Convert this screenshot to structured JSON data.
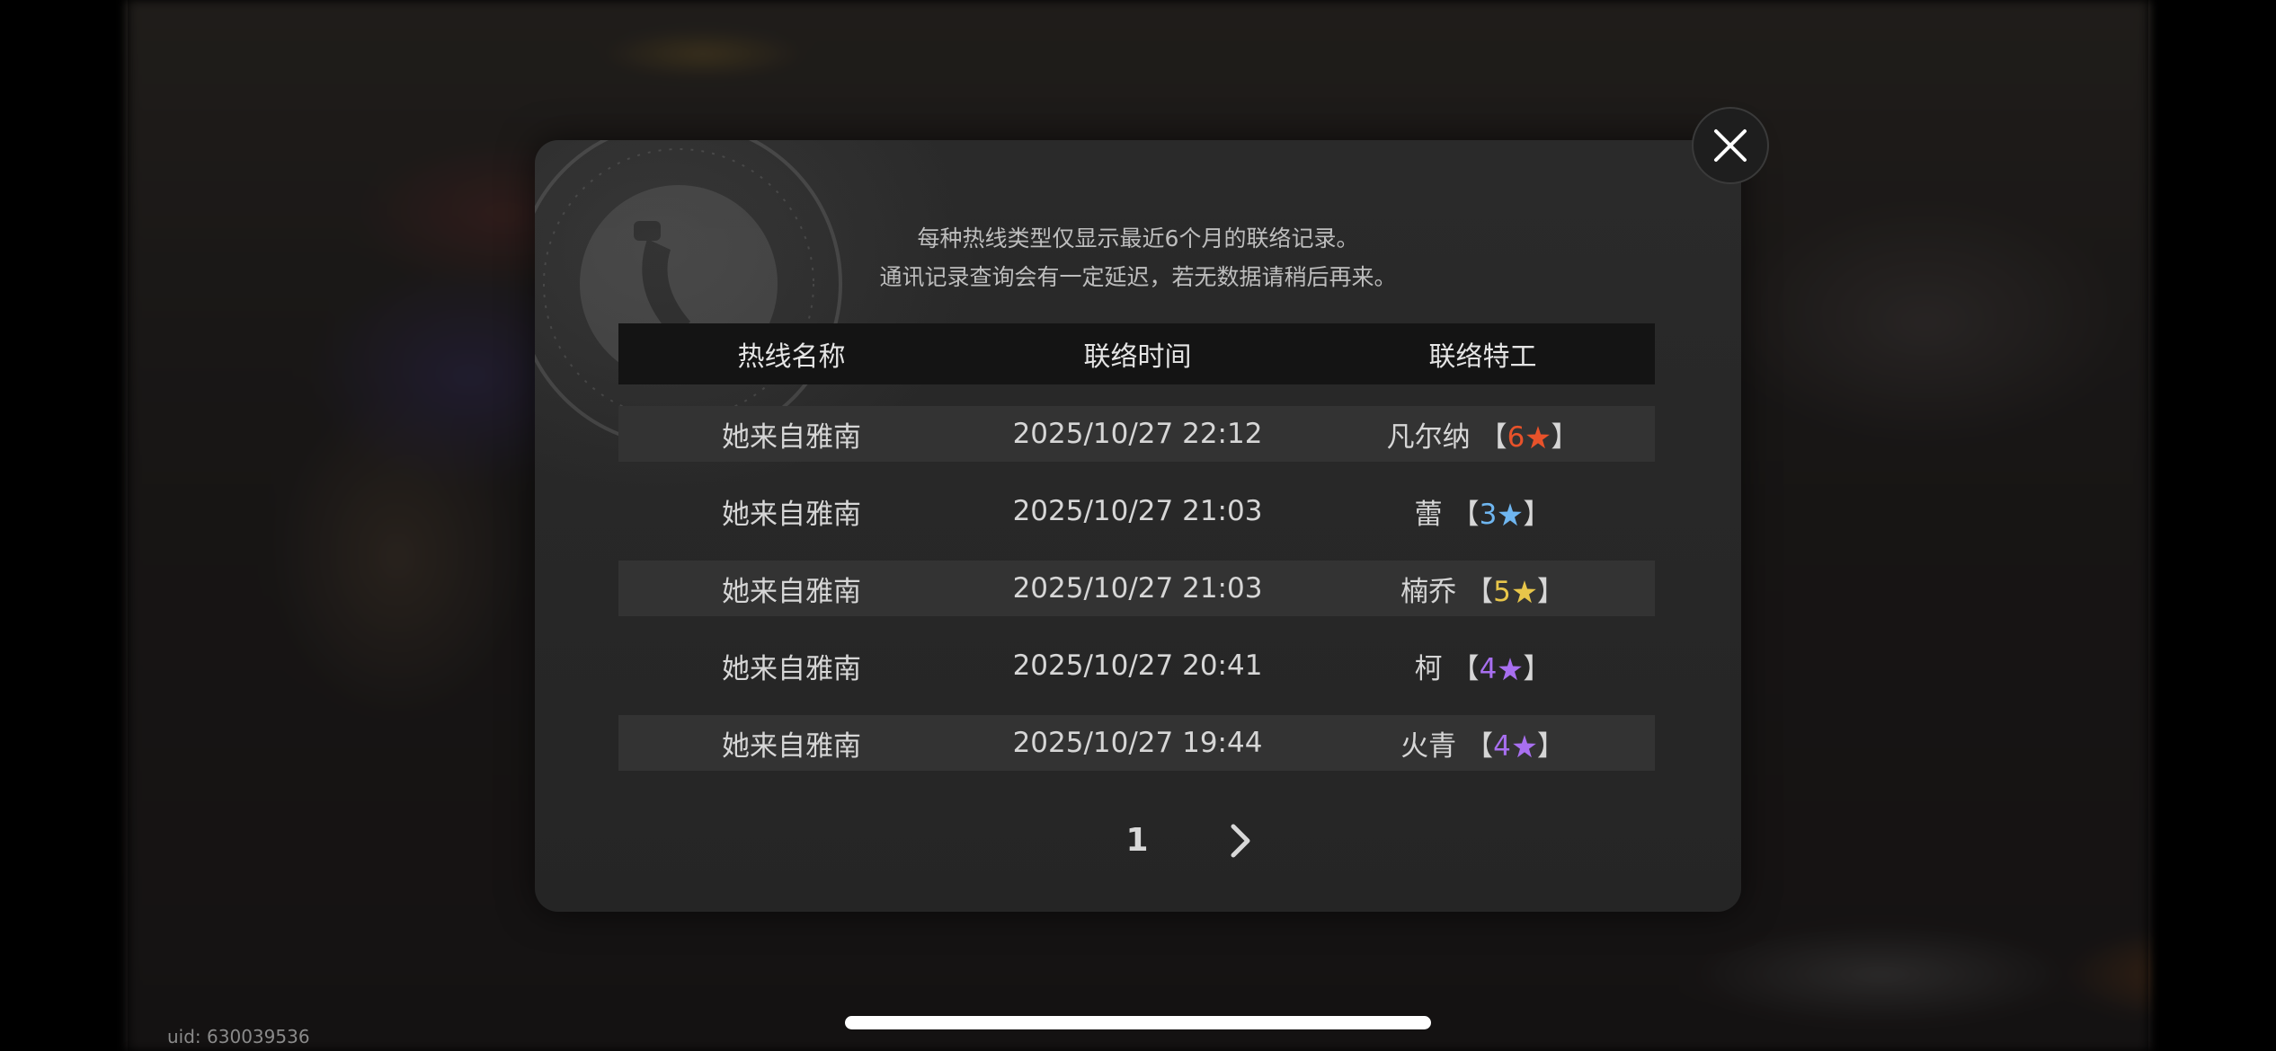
{
  "footer": {
    "uid": "uid: 630039536"
  },
  "modal": {
    "notice_lines": [
      "每种热线类型仅显示最近6个月的联络记录。",
      "通讯记录查询会有一定延迟，若无数据请稍后再来。"
    ],
    "columns": [
      "热线名称",
      "联络时间",
      "联络特工"
    ],
    "rows": [
      {
        "hotline": "她来自雅南",
        "time": "2025/10/27 22:12",
        "agent": "凡尔纳",
        "rank": "6",
        "rank_color": "#e8522a"
      },
      {
        "hotline": "她来自雅南",
        "time": "2025/10/27 21:03",
        "agent": "蕾",
        "rank": "3",
        "rank_color": "#6fb6f0"
      },
      {
        "hotline": "她来自雅南",
        "time": "2025/10/27 21:03",
        "agent": "楠乔",
        "rank": "5",
        "rank_color": "#e8c64a"
      },
      {
        "hotline": "她来自雅南",
        "time": "2025/10/27 20:41",
        "agent": "柯",
        "rank": "4",
        "rank_color": "#a86ff0"
      },
      {
        "hotline": "她来自雅南",
        "time": "2025/10/27 19:44",
        "agent": "火青",
        "rank": "4",
        "rank_color": "#a86ff0"
      }
    ],
    "pagination": {
      "current_page": "1"
    }
  },
  "icons": {
    "close": "close-icon",
    "next": "chevron-right-icon",
    "star": "star-icon",
    "emblem": "phone-emblem-icon"
  },
  "colors": {
    "modal_bg": "#272727",
    "header_bg": "#141414",
    "row_shade": "#333333",
    "rank_6": "#e8522a",
    "rank_5": "#e8c64a",
    "rank_4": "#a86ff0",
    "rank_3": "#6fb6f0"
  }
}
